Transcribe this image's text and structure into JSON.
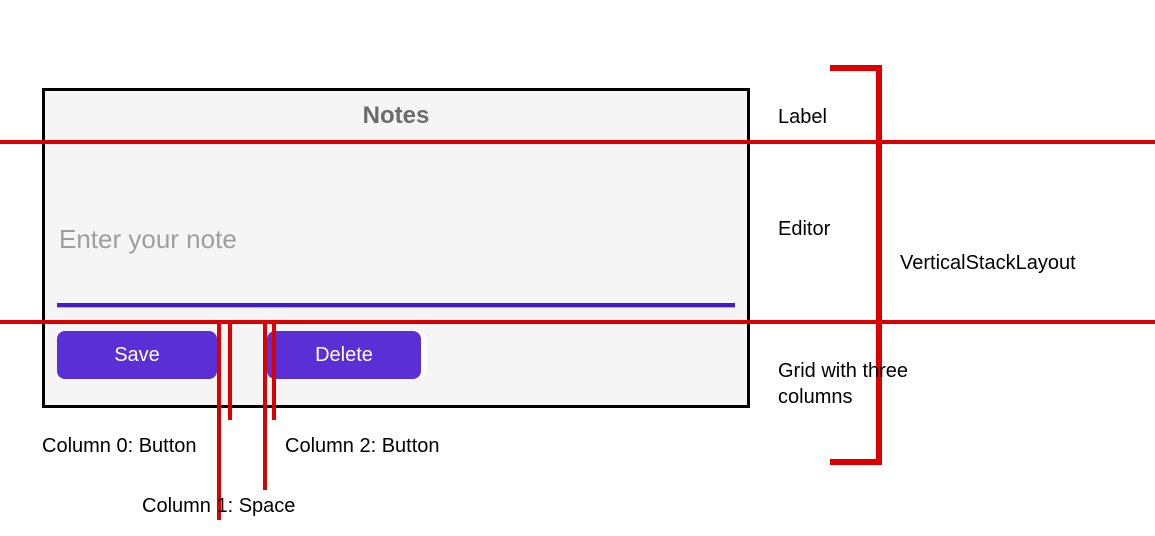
{
  "app": {
    "title": "Notes",
    "editor": {
      "placeholder": "Enter your note",
      "value": ""
    },
    "buttons": {
      "save": "Save",
      "delete": "Delete"
    }
  },
  "annotations": {
    "label": "Label",
    "editor": "Editor",
    "grid": "Grid with three columns",
    "vertical_stack": "VerticalStackLayout",
    "col0": "Column 0: Button",
    "col1": "Column 1: Space",
    "col2": "Column 2: Button"
  }
}
